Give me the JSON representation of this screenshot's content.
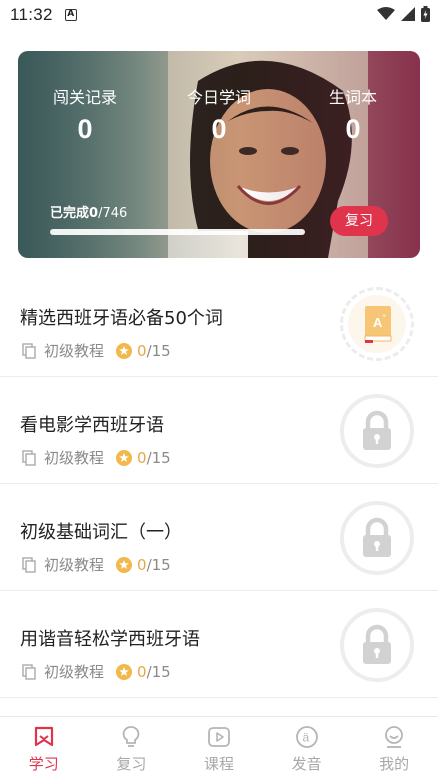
{
  "status_bar": {
    "time": "11:32",
    "notification_icon": "a-letter-icon"
  },
  "hero": {
    "stats": [
      {
        "label": "闯关记录",
        "value": "0"
      },
      {
        "label": "今日学词",
        "value": "0"
      },
      {
        "label": "生词本",
        "value": "0"
      }
    ],
    "progress_prefix": "已完成",
    "progress_done": "0",
    "progress_total": "/746",
    "progress_fraction": 0,
    "review_label": "复习"
  },
  "courses": [
    {
      "title": "精选西班牙语必备50个词",
      "level": "初级教程",
      "done": "0",
      "total": "/15",
      "state": "unlocked"
    },
    {
      "title": "看电影学西班牙语",
      "level": "初级教程",
      "done": "0",
      "total": "/15",
      "state": "locked"
    },
    {
      "title": "初级基础词汇（一）",
      "level": "初级教程",
      "done": "0",
      "total": "/15",
      "state": "locked"
    },
    {
      "title": "用谐音轻松学西班牙语",
      "level": "初级教程",
      "done": "0",
      "total": "/15",
      "state": "locked"
    }
  ],
  "tabs": [
    {
      "label": "学习",
      "icon": "bookmark-icon",
      "active": true
    },
    {
      "label": "复习",
      "icon": "lightbulb-icon",
      "active": false
    },
    {
      "label": "课程",
      "icon": "play-icon",
      "active": false
    },
    {
      "label": "发音",
      "icon": "pronunciation-icon",
      "active": false
    },
    {
      "label": "我的",
      "icon": "profile-icon",
      "active": false
    }
  ],
  "colors": {
    "accent": "#e0344d",
    "star": "#f2b84b",
    "muted": "#8a8a8a"
  }
}
